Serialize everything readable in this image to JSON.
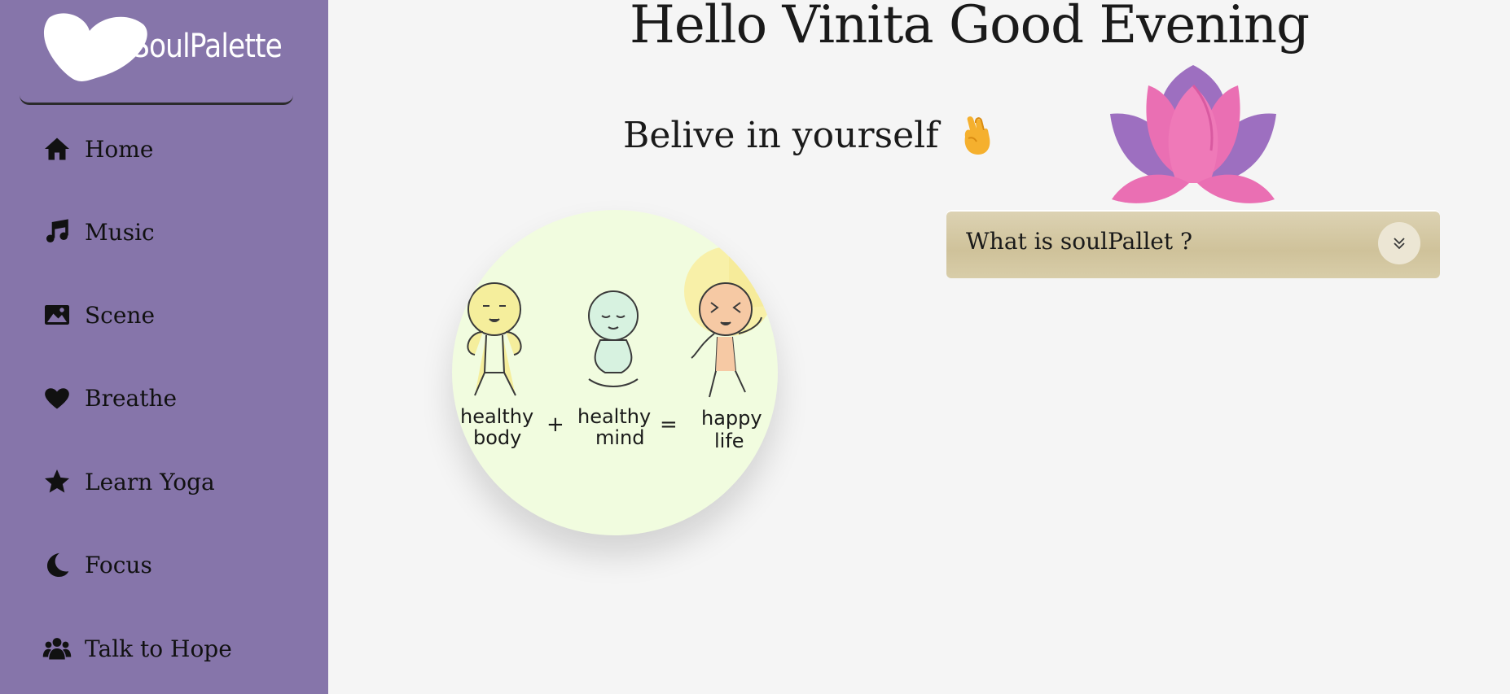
{
  "brand": {
    "name": "SoulPalette",
    "logo_icon": "heart-icon"
  },
  "nav": {
    "items": [
      {
        "label": "Home",
        "icon": "home-icon"
      },
      {
        "label": "Music",
        "icon": "music-note-icon"
      },
      {
        "label": "Scene",
        "icon": "image-icon"
      },
      {
        "label": "Breathe",
        "icon": "heart-icon"
      },
      {
        "label": "Learn Yoga",
        "icon": "star-icon"
      },
      {
        "label": "Focus",
        "icon": "moon-icon"
      },
      {
        "label": "Talk to Hope",
        "icon": "users-icon"
      }
    ]
  },
  "main": {
    "greeting": "Hello Vinita Good Evening",
    "quote": "Belive in yourself",
    "quote_emoji": "crossed-fingers-emoji",
    "illustration": {
      "labels": [
        "healthy",
        "body",
        "+",
        "healthy",
        "mind",
        "=",
        "happy",
        "life"
      ]
    },
    "faq": {
      "question": "What is soulPallet ?",
      "toggle_icon": "chevron-double-down-icon"
    }
  },
  "colors": {
    "sidebar": "#8675aa",
    "background": "#f5f5f5",
    "faq_background": "#d4c9a4",
    "lotus_pink": "#ea6fb3",
    "lotus_purple": "#9d6fc0"
  }
}
